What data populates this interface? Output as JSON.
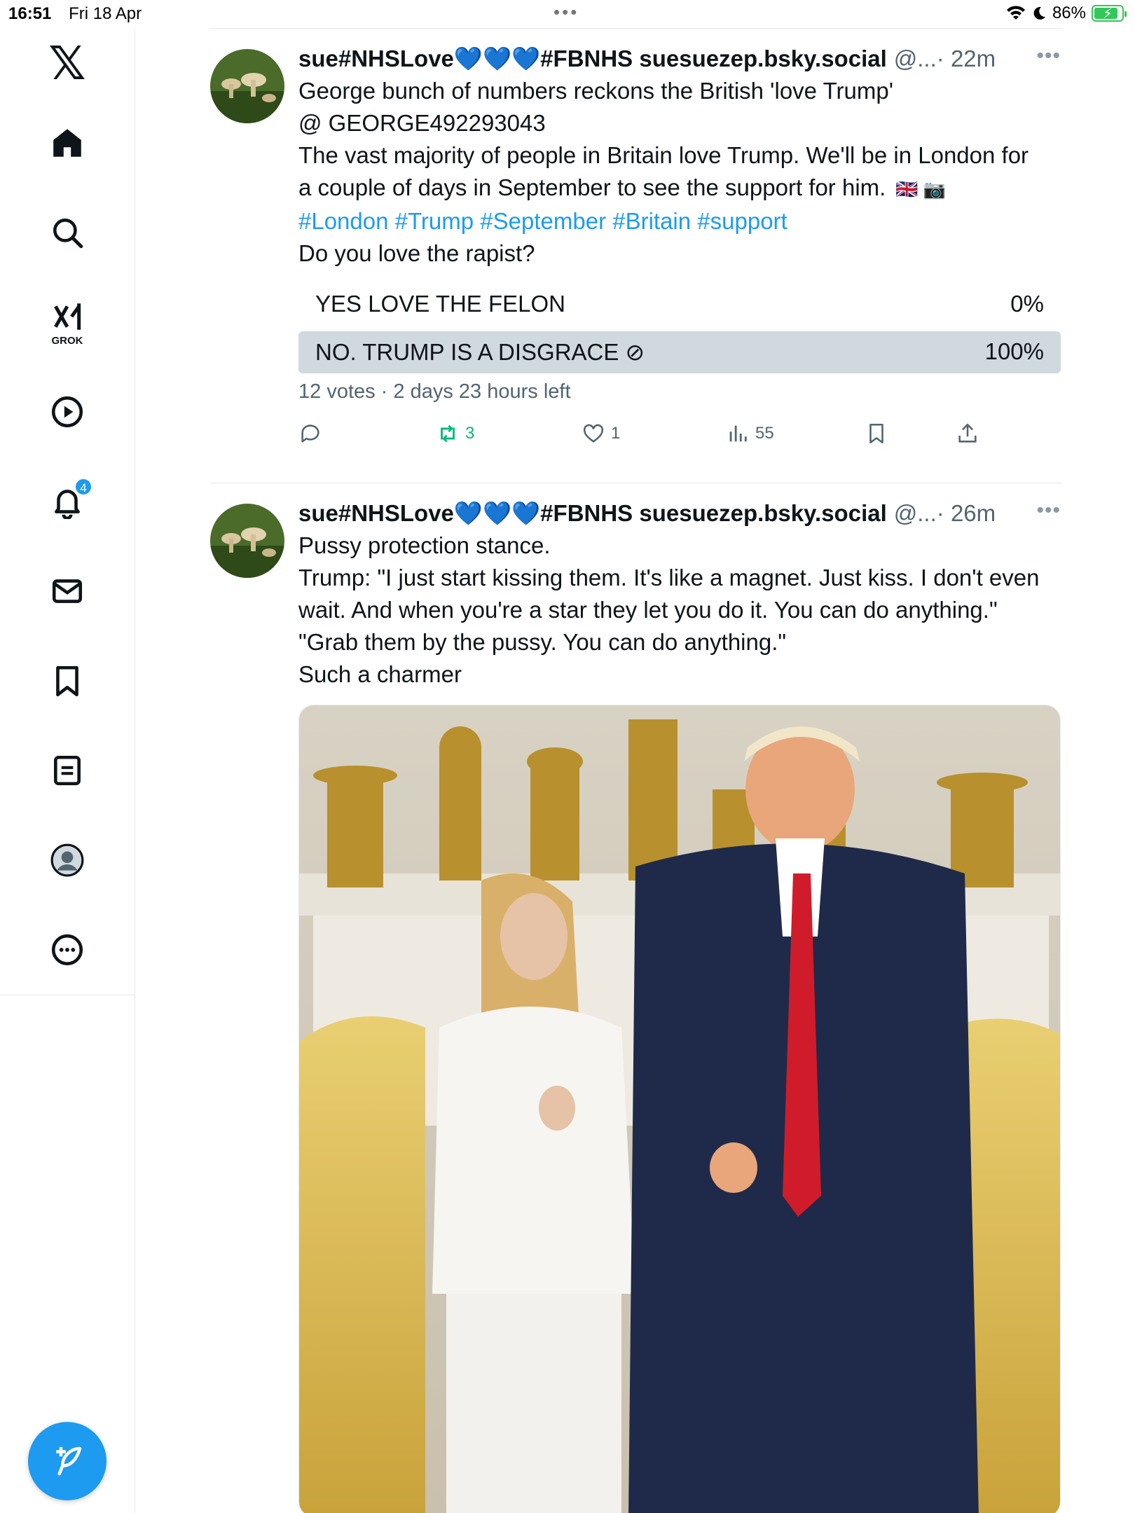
{
  "status_bar": {
    "time": "16:51",
    "date": "Fri 18 Apr",
    "multitask_dots": "•••",
    "battery_percent": "86%",
    "battery_level": 0.86
  },
  "sidebar": {
    "logo": "𝕏",
    "items": [
      {
        "name": "home",
        "icon": "home-icon"
      },
      {
        "name": "explore",
        "icon": "search-icon"
      },
      {
        "name": "grok",
        "icon": "grok-icon",
        "label": "GROK"
      },
      {
        "name": "video",
        "icon": "play-icon"
      },
      {
        "name": "notifications",
        "icon": "bell-icon",
        "badge": "4"
      },
      {
        "name": "messages",
        "icon": "mail-icon"
      },
      {
        "name": "bookmarks",
        "icon": "bookmark-icon"
      },
      {
        "name": "lists",
        "icon": "list-icon"
      },
      {
        "name": "profile",
        "icon": "avatar-icon"
      },
      {
        "name": "more",
        "icon": "more-circle-icon"
      }
    ],
    "compose_icon": "compose-icon"
  },
  "tweets": [
    {
      "name": "sue#NHSLove💙💙💙#FBNHS suesuezep.bsky.social",
      "handle": "@...",
      "time": "· 22m",
      "more": "•••",
      "lines": [
        "George bunch of numbers reckons the British 'love Trump'",
        "@ GEORGE492293043",
        "The vast majority of people in Britain love Trump. We'll be in London for",
        "a couple of days in September to see the support for him."
      ],
      "flags": "🇬🇧 📷",
      "hashtags": "#London #Trump #September #Britain #support",
      "last_line": "Do you love the rapist?",
      "poll": {
        "options": [
          {
            "label": "YES LOVE THE FELON",
            "percent": "0%",
            "value": 0,
            "chosen": false
          },
          {
            "label": "NO. TRUMP IS A DISGRACE ⊘",
            "percent": "100%",
            "value": 100,
            "chosen": true
          }
        ],
        "meta": "12 votes · 2 days 23 hours left"
      },
      "actions": {
        "replies": "",
        "retweets": "3",
        "likes": "1",
        "views": "55"
      }
    },
    {
      "name": "sue#NHSLove💙💙💙#FBNHS suesuezep.bsky.social",
      "handle": "@...",
      "time": "· 26m",
      "more": "•••",
      "lines": [
        "Pussy protection stance.",
        "Trump: \"I just start kissing them. It's like a magnet. Just kiss. I don't even",
        "wait. And when you're a star they let you do it. You can do anything.\"",
        "\"Grab them by the pussy. You can do anything.\"",
        "Such a charmer"
      ]
    }
  ],
  "colors": {
    "accent": "#1d9bf0",
    "retweet_green": "#00ba7c",
    "poll_bar": "#cfd9de",
    "text": "#0f1419",
    "muted": "#536471"
  }
}
